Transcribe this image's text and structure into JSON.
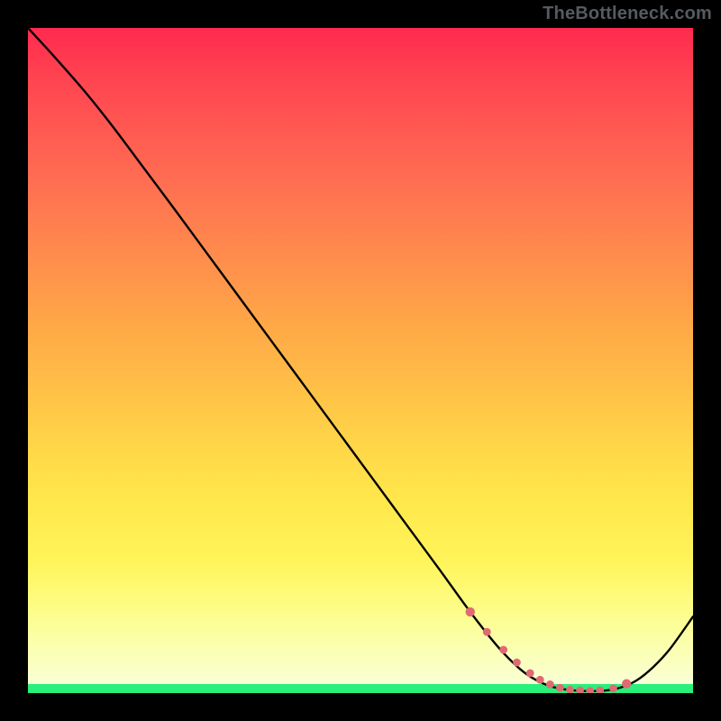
{
  "watermark": "TheBottleneck.com",
  "chart_data": {
    "type": "line",
    "title": "",
    "xlabel": "",
    "ylabel": "",
    "xlim": [
      0,
      100
    ],
    "ylim": [
      0,
      100
    ],
    "series": [
      {
        "name": "bottleneck-curve",
        "x": [
          0.0,
          3.5,
          8.5,
          12.5,
          17.0,
          22.0,
          27.0,
          32.0,
          37.0,
          42.0,
          47.0,
          52.0,
          57.0,
          62.0,
          66.5,
          70.8,
          74.0,
          76.5,
          79.0,
          81.5,
          84.0,
          86.5,
          89.0,
          91.5,
          94.0,
          96.5,
          100.0
        ],
        "values": [
          100.0,
          96.2,
          90.5,
          85.5,
          79.5,
          72.8,
          66.0,
          59.2,
          52.4,
          45.6,
          38.8,
          32.0,
          25.2,
          18.4,
          12.2,
          6.8,
          3.6,
          1.9,
          0.9,
          0.45,
          0.3,
          0.35,
          0.8,
          1.9,
          3.9,
          6.6,
          11.5
        ]
      }
    ],
    "markers": {
      "name": "trough-markers",
      "color": "#e06a72",
      "x": [
        66.5,
        69.0,
        71.5,
        73.5,
        75.5,
        77.0,
        78.5,
        80.0,
        81.5,
        83.0,
        84.5,
        86.0,
        88.0,
        90.0
      ],
      "values": [
        12.2,
        9.2,
        6.5,
        4.6,
        3.0,
        2.0,
        1.3,
        0.8,
        0.5,
        0.4,
        0.3,
        0.4,
        0.7,
        1.4
      ]
    },
    "background": {
      "gradient_top": "#ff2a4e",
      "gradient_bottom": "#f9ffd5",
      "bottom_band": "#29f07a"
    }
  }
}
